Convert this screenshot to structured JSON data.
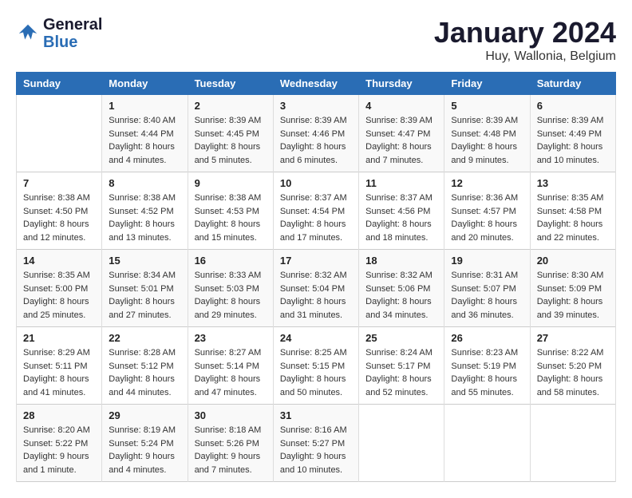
{
  "header": {
    "logo_line1": "General",
    "logo_line2": "Blue",
    "month_title": "January 2024",
    "location": "Huy, Wallonia, Belgium"
  },
  "days_of_week": [
    "Sunday",
    "Monday",
    "Tuesday",
    "Wednesday",
    "Thursday",
    "Friday",
    "Saturday"
  ],
  "weeks": [
    [
      {
        "day": "",
        "sunrise": "",
        "sunset": "",
        "daylight": ""
      },
      {
        "day": "1",
        "sunrise": "Sunrise: 8:40 AM",
        "sunset": "Sunset: 4:44 PM",
        "daylight": "Daylight: 8 hours and 4 minutes."
      },
      {
        "day": "2",
        "sunrise": "Sunrise: 8:39 AM",
        "sunset": "Sunset: 4:45 PM",
        "daylight": "Daylight: 8 hours and 5 minutes."
      },
      {
        "day": "3",
        "sunrise": "Sunrise: 8:39 AM",
        "sunset": "Sunset: 4:46 PM",
        "daylight": "Daylight: 8 hours and 6 minutes."
      },
      {
        "day": "4",
        "sunrise": "Sunrise: 8:39 AM",
        "sunset": "Sunset: 4:47 PM",
        "daylight": "Daylight: 8 hours and 7 minutes."
      },
      {
        "day": "5",
        "sunrise": "Sunrise: 8:39 AM",
        "sunset": "Sunset: 4:48 PM",
        "daylight": "Daylight: 8 hours and 9 minutes."
      },
      {
        "day": "6",
        "sunrise": "Sunrise: 8:39 AM",
        "sunset": "Sunset: 4:49 PM",
        "daylight": "Daylight: 8 hours and 10 minutes."
      }
    ],
    [
      {
        "day": "7",
        "sunrise": "Sunrise: 8:38 AM",
        "sunset": "Sunset: 4:50 PM",
        "daylight": "Daylight: 8 hours and 12 minutes."
      },
      {
        "day": "8",
        "sunrise": "Sunrise: 8:38 AM",
        "sunset": "Sunset: 4:52 PM",
        "daylight": "Daylight: 8 hours and 13 minutes."
      },
      {
        "day": "9",
        "sunrise": "Sunrise: 8:38 AM",
        "sunset": "Sunset: 4:53 PM",
        "daylight": "Daylight: 8 hours and 15 minutes."
      },
      {
        "day": "10",
        "sunrise": "Sunrise: 8:37 AM",
        "sunset": "Sunset: 4:54 PM",
        "daylight": "Daylight: 8 hours and 17 minutes."
      },
      {
        "day": "11",
        "sunrise": "Sunrise: 8:37 AM",
        "sunset": "Sunset: 4:56 PM",
        "daylight": "Daylight: 8 hours and 18 minutes."
      },
      {
        "day": "12",
        "sunrise": "Sunrise: 8:36 AM",
        "sunset": "Sunset: 4:57 PM",
        "daylight": "Daylight: 8 hours and 20 minutes."
      },
      {
        "day": "13",
        "sunrise": "Sunrise: 8:35 AM",
        "sunset": "Sunset: 4:58 PM",
        "daylight": "Daylight: 8 hours and 22 minutes."
      }
    ],
    [
      {
        "day": "14",
        "sunrise": "Sunrise: 8:35 AM",
        "sunset": "Sunset: 5:00 PM",
        "daylight": "Daylight: 8 hours and 25 minutes."
      },
      {
        "day": "15",
        "sunrise": "Sunrise: 8:34 AM",
        "sunset": "Sunset: 5:01 PM",
        "daylight": "Daylight: 8 hours and 27 minutes."
      },
      {
        "day": "16",
        "sunrise": "Sunrise: 8:33 AM",
        "sunset": "Sunset: 5:03 PM",
        "daylight": "Daylight: 8 hours and 29 minutes."
      },
      {
        "day": "17",
        "sunrise": "Sunrise: 8:32 AM",
        "sunset": "Sunset: 5:04 PM",
        "daylight": "Daylight: 8 hours and 31 minutes."
      },
      {
        "day": "18",
        "sunrise": "Sunrise: 8:32 AM",
        "sunset": "Sunset: 5:06 PM",
        "daylight": "Daylight: 8 hours and 34 minutes."
      },
      {
        "day": "19",
        "sunrise": "Sunrise: 8:31 AM",
        "sunset": "Sunset: 5:07 PM",
        "daylight": "Daylight: 8 hours and 36 minutes."
      },
      {
        "day": "20",
        "sunrise": "Sunrise: 8:30 AM",
        "sunset": "Sunset: 5:09 PM",
        "daylight": "Daylight: 8 hours and 39 minutes."
      }
    ],
    [
      {
        "day": "21",
        "sunrise": "Sunrise: 8:29 AM",
        "sunset": "Sunset: 5:11 PM",
        "daylight": "Daylight: 8 hours and 41 minutes."
      },
      {
        "day": "22",
        "sunrise": "Sunrise: 8:28 AM",
        "sunset": "Sunset: 5:12 PM",
        "daylight": "Daylight: 8 hours and 44 minutes."
      },
      {
        "day": "23",
        "sunrise": "Sunrise: 8:27 AM",
        "sunset": "Sunset: 5:14 PM",
        "daylight": "Daylight: 8 hours and 47 minutes."
      },
      {
        "day": "24",
        "sunrise": "Sunrise: 8:25 AM",
        "sunset": "Sunset: 5:15 PM",
        "daylight": "Daylight: 8 hours and 50 minutes."
      },
      {
        "day": "25",
        "sunrise": "Sunrise: 8:24 AM",
        "sunset": "Sunset: 5:17 PM",
        "daylight": "Daylight: 8 hours and 52 minutes."
      },
      {
        "day": "26",
        "sunrise": "Sunrise: 8:23 AM",
        "sunset": "Sunset: 5:19 PM",
        "daylight": "Daylight: 8 hours and 55 minutes."
      },
      {
        "day": "27",
        "sunrise": "Sunrise: 8:22 AM",
        "sunset": "Sunset: 5:20 PM",
        "daylight": "Daylight: 8 hours and 58 minutes."
      }
    ],
    [
      {
        "day": "28",
        "sunrise": "Sunrise: 8:20 AM",
        "sunset": "Sunset: 5:22 PM",
        "daylight": "Daylight: 9 hours and 1 minute."
      },
      {
        "day": "29",
        "sunrise": "Sunrise: 8:19 AM",
        "sunset": "Sunset: 5:24 PM",
        "daylight": "Daylight: 9 hours and 4 minutes."
      },
      {
        "day": "30",
        "sunrise": "Sunrise: 8:18 AM",
        "sunset": "Sunset: 5:26 PM",
        "daylight": "Daylight: 9 hours and 7 minutes."
      },
      {
        "day": "31",
        "sunrise": "Sunrise: 8:16 AM",
        "sunset": "Sunset: 5:27 PM",
        "daylight": "Daylight: 9 hours and 10 minutes."
      },
      {
        "day": "",
        "sunrise": "",
        "sunset": "",
        "daylight": ""
      },
      {
        "day": "",
        "sunrise": "",
        "sunset": "",
        "daylight": ""
      },
      {
        "day": "",
        "sunrise": "",
        "sunset": "",
        "daylight": ""
      }
    ]
  ]
}
